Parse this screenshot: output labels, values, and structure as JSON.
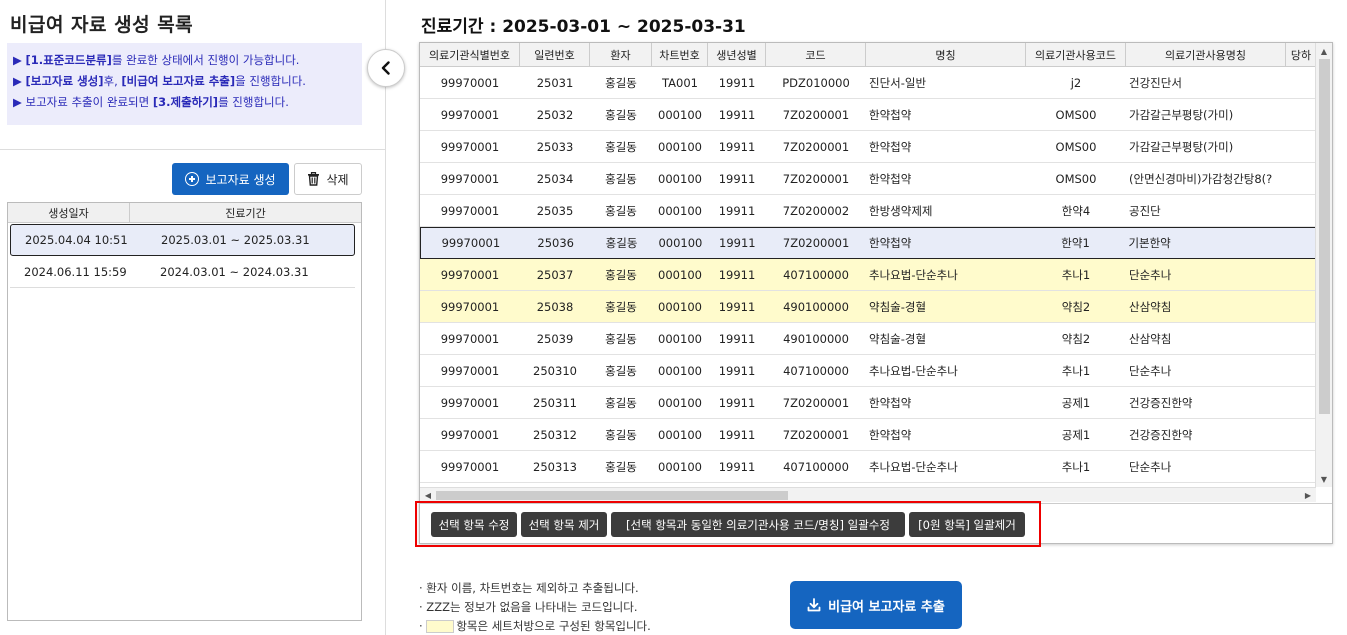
{
  "left": {
    "title": "비급여 자료 생성 목록",
    "notices": [
      {
        "pre": "",
        "bold": "[1.표준코드분류]",
        "post": "를 완료한 상태에서 진행이 가능합니다."
      },
      {
        "pre": "",
        "bold": "[보고자료 생성]",
        "post": "후, "
      },
      {
        "pre": "보고자료 추출이 완료되면 ",
        "bold": "[3.제출하기]",
        "post": "를 진행합니다."
      }
    ],
    "notice2_extra_bold": "[비급여 보고자료 추출]",
    "notice2_tail": "을 진행합니다.",
    "generate_label": "보고자료 생성",
    "delete_label": "삭제",
    "list_headers": [
      "생성일자",
      "진료기간"
    ],
    "list_rows": [
      {
        "created": "2025.04.04  10:51",
        "period": "2025.03.01 ~ 2025.03.31",
        "selected": true
      },
      {
        "created": "2024.06.11  15:59",
        "period": "2024.03.01 ~ 2024.03.31",
        "selected": false
      }
    ]
  },
  "main": {
    "title": "진료기간 : 2025-03-01 ~ 2025-03-31",
    "headers": [
      "의료기관식별번호",
      "일련번호",
      "환자",
      "차트번호",
      "생년성별",
      "코드",
      "명칭",
      "의료기관사용코드",
      "의료기관사용명칭",
      "당하"
    ],
    "rows": [
      {
        "c": [
          "99970001",
          "25031",
          "홍길동",
          "TA001",
          "19911",
          "PDZ010000",
          "진단서-일반",
          "j2",
          "건강진단서"
        ],
        "style": ""
      },
      {
        "c": [
          "99970001",
          "25032",
          "홍길동",
          "000100",
          "19911",
          "7Z0200001",
          "한약첩약",
          "OMS00",
          "가감갈근부평탕(가미)"
        ],
        "style": ""
      },
      {
        "c": [
          "99970001",
          "25033",
          "홍길동",
          "000100",
          "19911",
          "7Z0200001",
          "한약첩약",
          "OMS00",
          "가감갈근부평탕(가미)"
        ],
        "style": ""
      },
      {
        "c": [
          "99970001",
          "25034",
          "홍길동",
          "000100",
          "19911",
          "7Z0200001",
          "한약첩약",
          "OMS00",
          "(안면신경마비)가감청간탕8(?"
        ],
        "style": ""
      },
      {
        "c": [
          "99970001",
          "25035",
          "홍길동",
          "000100",
          "19911",
          "7Z0200002",
          "한방생약제제",
          "한약4",
          "공진단"
        ],
        "style": ""
      },
      {
        "c": [
          "99970001",
          "25036",
          "홍길동",
          "000100",
          "19911",
          "7Z0200001",
          "한약첩약",
          "한약1",
          "기본한약"
        ],
        "style": "sel"
      },
      {
        "c": [
          "99970001",
          "25037",
          "홍길동",
          "000100",
          "19911",
          "407100000",
          "추나요법-단순추나",
          "추나1",
          "단순추나"
        ],
        "style": "yellow"
      },
      {
        "c": [
          "99970001",
          "25038",
          "홍길동",
          "000100",
          "19911",
          "490100000",
          "약침술-경혈",
          "약침2",
          "산삼약침"
        ],
        "style": "yellow"
      },
      {
        "c": [
          "99970001",
          "25039",
          "홍길동",
          "000100",
          "19911",
          "490100000",
          "약침술-경혈",
          "약침2",
          "산삼약침"
        ],
        "style": ""
      },
      {
        "c": [
          "99970001",
          "250310",
          "홍길동",
          "000100",
          "19911",
          "407100000",
          "추나요법-단순추나",
          "추나1",
          "단순추나"
        ],
        "style": ""
      },
      {
        "c": [
          "99970001",
          "250311",
          "홍길동",
          "000100",
          "19911",
          "7Z0200001",
          "한약첩약",
          "공제1",
          "건강증진한약"
        ],
        "style": ""
      },
      {
        "c": [
          "99970001",
          "250312",
          "홍길동",
          "000100",
          "19911",
          "7Z0200001",
          "한약첩약",
          "공제1",
          "건강증진한약"
        ],
        "style": ""
      },
      {
        "c": [
          "99970001",
          "250313",
          "홍길동",
          "000100",
          "19911",
          "407100000",
          "추나요법-단순추나",
          "추나1",
          "단순추나"
        ],
        "style": ""
      }
    ],
    "toolbar": {
      "edit": "선택 항목 수정",
      "remove": "선택 항목 제거",
      "bulk_edit": "[선택 항목과 동일한 의료기관사용 코드/명칭]  일괄수정",
      "bulk_remove": "[0원 항목]  일괄제거"
    },
    "notes": [
      "· 환자 이름, 차트번호는 제외하고 추출됩니다.",
      "· ZZZ는 정보가 없음을 나타내는 코드입니다.",
      "항목은 세트처방으로 구성된 항목입니다."
    ],
    "notes_prefix": "· ",
    "export_label": "비급여 보고자료 추출"
  },
  "colors": {
    "accent": "#1565c0",
    "set_row": "#fffbcc",
    "notice_bg": "#ececfb",
    "notice_text": "#2a2ab8",
    "highlight_box": "#e00000"
  }
}
